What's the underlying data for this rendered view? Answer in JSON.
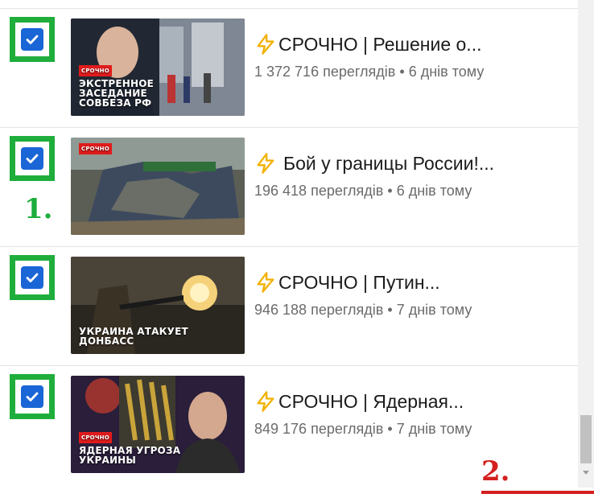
{
  "videos": [
    {
      "title": "СРОЧНО | Решение о...",
      "views": "1 372 716 переглядів",
      "age": "6 днів тому",
      "thumb_badge": "СРОЧНО",
      "thumb_text": "ЭКСТРЕННОЕ ЗАСЕДАНИЕ СОВБЕЗА РФ",
      "checked": true
    },
    {
      "title": "Бой у границы России!...",
      "views": "196 418 переглядів",
      "age": "6 днів тому",
      "thumb_badge": "СРОЧНО",
      "thumb_text": "",
      "checked": true
    },
    {
      "title": "СРОЧНО | Путин...",
      "views": "946 188 переглядів",
      "age": "7 днів тому",
      "thumb_badge": "",
      "thumb_text": "УКРАИНА АТАКУЕТ ДОНБАСС",
      "checked": true
    },
    {
      "title": "СРОЧНО | Ядерная...",
      "views": "849 176 переглядів",
      "age": "7 днів тому",
      "thumb_badge": "СРОЧНО",
      "thumb_text": "ЯДЕРНАЯ УГРОЗА УКРАИНЫ",
      "checked": true
    }
  ],
  "annotations": {
    "step1": "1.",
    "step2": "2."
  },
  "separator": "•",
  "colors": {
    "highlight_green": "#1fae3c",
    "checkbox_blue": "#1a66d6",
    "bolt_yellow": "#f2b100",
    "annotation_red": "#d42020"
  },
  "icons": {
    "checkbox": "checkmark-icon",
    "bolt": "lightning-bolt-icon",
    "scroll_down": "chevron-down-icon"
  }
}
